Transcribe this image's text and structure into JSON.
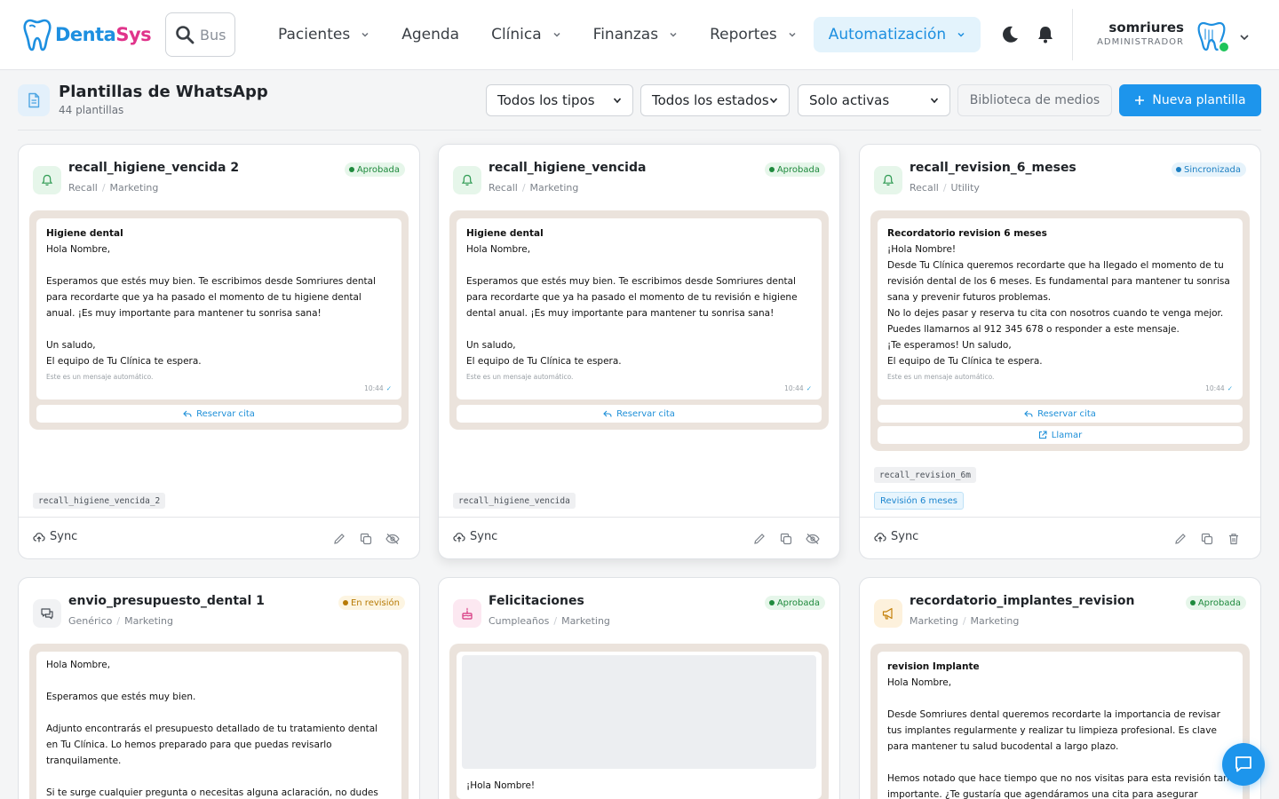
{
  "app": {
    "logo_part1": "Denta",
    "logo_part2": "Sys",
    "search_placeholder": "Buscar"
  },
  "nav": {
    "items": [
      {
        "label": "Pacientes"
      },
      {
        "label": "Agenda"
      },
      {
        "label": "Clínica"
      },
      {
        "label": "Finanzas"
      },
      {
        "label": "Reportes"
      },
      {
        "label": "Automatización"
      }
    ]
  },
  "user": {
    "name": "somriures",
    "role": "ADMINISTRADOR"
  },
  "page": {
    "title": "Plantillas de WhatsApp",
    "subtitle": "44 plantillas",
    "filters": {
      "type": "Todos los tipos",
      "status": "Todos los estados",
      "active": "Solo activas"
    },
    "media_button": "Biblioteca de medios",
    "new_button": "Nueva plantilla"
  },
  "card_actions": {
    "sync": "Sync"
  },
  "cards": [
    {
      "name": "recall_higiene_vencida 2",
      "category": "Recall",
      "type": "Marketing",
      "status": "Aprobada",
      "icon": "bell-icon",
      "preview_header": "Higiene dental",
      "preview_body": "Hola Nombre,\n\nEsperamos que estés muy bien. Te escribimos desde Somriures dental para recordarte que ya ha pasado el momento de tu higiene dental anual. ¡Es muy importante para mantener tu sonrisa sana!\n\nUn saludo,\nEl equipo de Tu Clínica te espera.",
      "preview_footer": "Este es un mensaje automático.",
      "time": "10:44",
      "buttons": [
        "Reservar cita"
      ],
      "code": "recall_higiene_vencida_2"
    },
    {
      "name": "recall_higiene_vencida",
      "category": "Recall",
      "type": "Marketing",
      "status": "Aprobada",
      "icon": "bell-icon",
      "preview_header": "Higiene dental",
      "preview_body": "Hola Nombre,\n\nEsperamos que estés muy bien. Te escribimos desde Somriures dental para recordarte que ya ha pasado el momento de tu revisión e higiene dental anual. ¡Es muy importante para mantener tu sonrisa sana!\n\nUn saludo,\nEl equipo de Tu Clínica te espera.",
      "preview_footer": "Este es un mensaje automático.",
      "time": "10:44",
      "buttons": [
        "Reservar cita"
      ],
      "code": "recall_higiene_vencida"
    },
    {
      "name": "recall_revision_6_meses",
      "category": "Recall",
      "type": "Utility",
      "status": "Sincronizada",
      "icon": "bell-icon",
      "preview_header": "Recordatorio revision 6 meses",
      "preview_body": "¡Hola Nombre!\nDesde Tu Clínica queremos recordarte que ha llegado el momento de tu revisión dental de los 6 meses. Es fundamental para mantener tu sonrisa sana y prevenir futuros problemas.\nNo lo dejes pasar y reserva tu cita con nosotros cuando te venga mejor. Puedes llamarnos al 912 345 678 o responder a este mensaje.\n¡Te esperamos! Un saludo,\nEl equipo de Tu Clínica te espera.",
      "preview_footer": "Este es un mensaje automático.",
      "time": "10:44",
      "buttons": [
        "Reservar cita",
        "Llamar"
      ],
      "code": "recall_revision_6m",
      "trigger": "Revisión 6 meses"
    },
    {
      "name": "envio_presupuesto_dental 1",
      "category": "Genérico",
      "type": "Marketing",
      "status": "En revisión",
      "icon": "chat-icon",
      "preview_body": "Hola Nombre,\n\nEsperamos que estés muy bien.\n\nAdjunto encontrarás el presupuesto detallado de tu tratamiento dental en Tu Clínica. Lo hemos preparado para que puedas revisarlo tranquilamente.\n\nSi te surge cualquier pregunta o necesitas alguna aclaración, no dudes"
    },
    {
      "name": "Felicitaciones",
      "category": "Cumpleaños",
      "type": "Marketing",
      "status": "Aprobada",
      "icon": "cake-icon",
      "preview_body": "¡Hola Nombre!"
    },
    {
      "name": "recordatorio_implantes_revision",
      "category": "Marketing",
      "type": "Marketing",
      "status": "Aprobada",
      "icon": "megaphone-icon",
      "preview_header": "revision Implante",
      "preview_body": "Hola Nombre,\n\nDesde Somriures dental queremos recordarte la importancia de revisar tus implantes regularmente y realizar tu limpieza profesional. Es clave para mantener tu salud bucodental a largo plazo.\n\nHemos notado que hace tiempo que no nos visitas para esta revisión tan importante. ¿Te gustaría que agendáramos una cita para asegurar"
    }
  ],
  "colors": {
    "accent": "#1d95ec",
    "logo_blue": "#1d8fe0",
    "logo_pink": "#e0348b"
  }
}
